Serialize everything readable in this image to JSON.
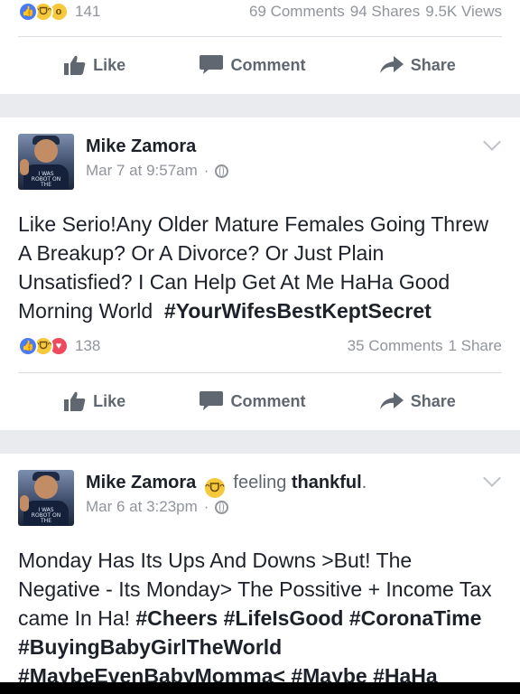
{
  "post1": {
    "reaction_count": "141",
    "meta": {
      "comments": "69 Comments",
      "shares": "94 Shares",
      "views": "9.5K Views"
    }
  },
  "actions": {
    "like": "Like",
    "comment": "Comment",
    "share": "Share"
  },
  "post2": {
    "author": "Mike Zamora",
    "date": "Mar 7 at 9:57am",
    "separator": "·",
    "text": "Like Serio!Any Older Mature Females Going Threw A Breakup? Or A Divorce? Or Just Plain Unsatisfied? I Can Help Get At Me HaHa Good Morning World",
    "hashtag": "#YourWifesBestKeptSecret",
    "reaction_count": "138",
    "meta": {
      "comments": "35 Comments",
      "shares": "1 Share"
    }
  },
  "post3": {
    "author": "Mike Zamora",
    "feeling_prefix": "feeling",
    "feeling": "thankful",
    "feeling_suffix": ".",
    "date": "Mar 6 at 3:23pm",
    "separator": "·",
    "text": "Monday Has Its Ups And Downs  >But! The Negative - Its Monday> The Possitive + Income Tax came In Ha!",
    "tags": [
      "#Cheers",
      "#LifeIsGood",
      "#CoronaTime",
      "#BuyingBabyGirlTheWorld",
      "#MaybeEvenBabyMomma",
      "#Maybe",
      "#HaHa"
    ],
    "tag_joiner": "<"
  },
  "avatar": {
    "shirt_text": "I WAS ROBOT ON THE"
  },
  "icons": {
    "like_reaction": "thumbs-up-icon",
    "haha_reaction": "laughing-face-icon",
    "wow_reaction": "surprised-face-icon",
    "love_reaction": "heart-icon",
    "like_action": "thumbs-up-icon",
    "comment_action": "speech-bubble-icon",
    "share_action": "share-arrow-icon",
    "privacy": "globe-icon",
    "menu": "chevron-down-icon",
    "feeling": "smiley-face-icon"
  },
  "colors": {
    "link": "#4267b2",
    "meta_text": "#90949c",
    "action_text": "#606770",
    "separator_bg": "#e9ebee"
  }
}
